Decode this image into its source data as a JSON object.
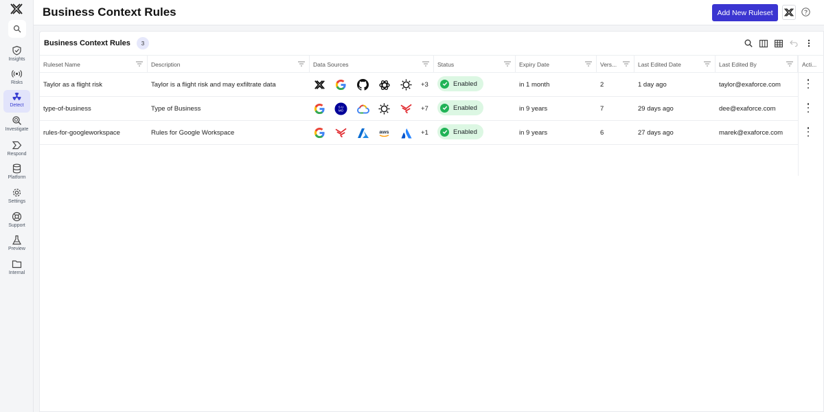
{
  "sidebar": {
    "items": [
      {
        "label": "Insights",
        "icon": "shield-check-icon"
      },
      {
        "label": "Risks",
        "icon": "radar-icon"
      },
      {
        "label": "Detect",
        "icon": "radiation-icon"
      },
      {
        "label": "Investigate",
        "icon": "magnifier-icon"
      },
      {
        "label": "Respond",
        "icon": "chevron-arrow-icon"
      },
      {
        "label": "Platform",
        "icon": "database-icon"
      },
      {
        "label": "Settings",
        "icon": "gear-icon"
      },
      {
        "label": "Support",
        "icon": "lifebuoy-icon"
      },
      {
        "label": "Preview",
        "icon": "flask-icon"
      },
      {
        "label": "Internal",
        "icon": "folder-icon"
      }
    ],
    "active": "Detect"
  },
  "header": {
    "title": "Business Context Rules",
    "add_button": "Add New Ruleset"
  },
  "table": {
    "title": "Business Context Rules",
    "count": "3",
    "columns": [
      "Ruleset Name",
      "Description",
      "Data Sources",
      "Status",
      "Expiry Date",
      "Vers...",
      "Last Edited Date",
      "Last Edited By",
      "Acti..."
    ],
    "rows": [
      {
        "name": "Taylor as a flight risk",
        "description": "Taylor is a flight risk and may exfiltrate data",
        "sources": [
          "exaforce",
          "google",
          "github",
          "openai",
          "sunburst"
        ],
        "extra": "+3",
        "status": "Enabled",
        "expiry": "in 1 month",
        "version": "2",
        "edited_date": "1 day ago",
        "edited_by": "taylor@exaforce.com"
      },
      {
        "name": "type-of-business",
        "description": "Type of Business",
        "sources": [
          "google",
          "sumo",
          "gcloud",
          "sunburst",
          "fortinet"
        ],
        "extra": "+7",
        "status": "Enabled",
        "expiry": "in 9 years",
        "version": "7",
        "edited_date": "29 days ago",
        "edited_by": "dee@exaforce.com"
      },
      {
        "name": "rules-for-googleworkspace",
        "description": "Rules for Google Workspace",
        "sources": [
          "google",
          "fortinet",
          "azure",
          "aws",
          "atlassian"
        ],
        "extra": "+1",
        "status": "Enabled",
        "expiry": "in 9 years",
        "version": "6",
        "edited_date": "27 days ago",
        "edited_by": "marek@exaforce.com"
      }
    ]
  },
  "colors": {
    "accent": "#3b35d1",
    "enabled_bg": "#dcf7e3",
    "enabled_dot": "#20b356"
  }
}
